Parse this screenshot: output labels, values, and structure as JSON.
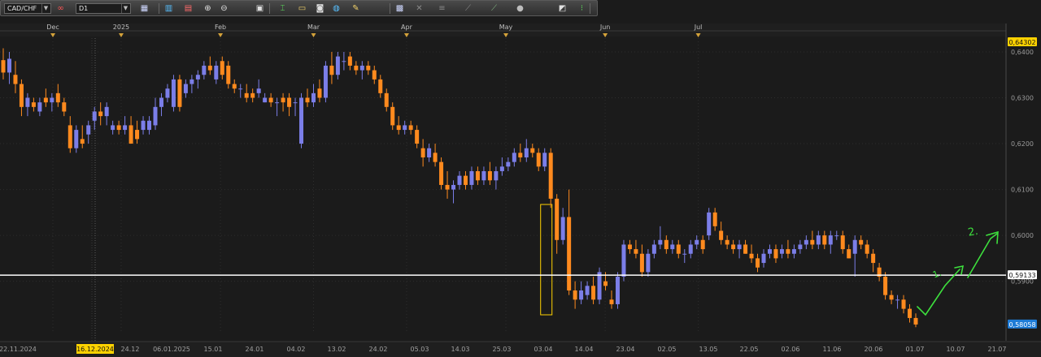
{
  "toolbar": {
    "symbol": "CAD/CHF",
    "timeframe": "D1",
    "icons": [
      {
        "name": "link-icon",
        "glyph": "∞",
        "color": "#ff5555"
      },
      {
        "name": "chart-type-icon",
        "glyph": "▦",
        "color": "#cfd8ff"
      },
      {
        "name": "bar-chart-icon",
        "glyph": "▥",
        "color": "#58c0ff"
      },
      {
        "name": "indicator-icon",
        "glyph": "▤",
        "color": "#ff6b6b"
      },
      {
        "name": "zoom-in-icon",
        "glyph": "⊕",
        "color": "#e0e0e0"
      },
      {
        "name": "zoom-out-icon",
        "glyph": "⊖",
        "color": "#e0e0e0"
      },
      {
        "name": "grid-icon",
        "glyph": "▣",
        "color": "#e0e0e0"
      },
      {
        "name": "cursor-icon",
        "glyph": "⌶",
        "color": "#5bdc5b"
      },
      {
        "name": "template-icon",
        "glyph": "▭",
        "color": "#f2d26a"
      },
      {
        "name": "camera-icon",
        "glyph": "◙",
        "color": "#e0e0e0"
      },
      {
        "name": "globe-icon",
        "glyph": "◍",
        "color": "#58c0ff"
      },
      {
        "name": "pencil-icon",
        "glyph": "✎",
        "color": "#f2d26a"
      },
      {
        "name": "tile-windows-icon",
        "glyph": "▩",
        "color": "#cfd8ff"
      },
      {
        "name": "crosshair-icon",
        "glyph": "✕",
        "color": "#8a8a8a"
      },
      {
        "name": "levels-icon",
        "glyph": "≡",
        "color": "#8a8a8a"
      },
      {
        "name": "trendline-icon",
        "glyph": "⟋",
        "color": "#8a8a8a"
      },
      {
        "name": "channel-icon",
        "glyph": "⟋",
        "color": "#7fb27f"
      },
      {
        "name": "shapes-icon",
        "glyph": "●",
        "color": "#bdbdbd"
      },
      {
        "name": "eraser-icon",
        "glyph": "◩",
        "color": "#e0e0e0"
      },
      {
        "name": "more-icon",
        "glyph": "⁝",
        "color": "#5bdc5b"
      }
    ]
  },
  "time_axis_top": [
    {
      "label": "Dec",
      "idx": 8
    },
    {
      "label": "2025",
      "idx": 19
    },
    {
      "label": "Feb",
      "idx": 35
    },
    {
      "label": "Mar",
      "idx": 50
    },
    {
      "label": "Apr",
      "idx": 65
    },
    {
      "label": "May",
      "idx": 81
    },
    {
      "label": "Jun",
      "idx": 97
    },
    {
      "label": "Jul",
      "idx": 112
    }
  ],
  "price_axis": {
    "labels": [
      "0,6400",
      "0,6300",
      "0,6200",
      "0,6100",
      "0,6000",
      "0,5900"
    ],
    "top_label": "0,64302",
    "hline_label": "0,59133",
    "last_label": "0,58058"
  },
  "date_axis": {
    "highlight": "16.12.2024",
    "labels": [
      "22.11.2024",
      "24.12",
      "06.01.2025",
      "15.01",
      "24.01",
      "04.02",
      "13.02",
      "24.02",
      "05.03",
      "14.03",
      "25.03",
      "03.04",
      "14.04",
      "23.04",
      "02.05",
      "13.05",
      "22.05",
      "02.06",
      "11.06",
      "20.06",
      "01.07",
      "10.07",
      "21.07"
    ]
  },
  "annotations": {
    "label1": "1.",
    "label2": "2.",
    "highlight_candle_index": 89
  },
  "chart_data": {
    "type": "candlestick",
    "symbol": "CAD/CHF",
    "timeframe": "D1",
    "ylim": [
      0.5788,
      0.643
    ],
    "horizontal_line": 0.59133,
    "last_price": 0.58058,
    "colors": {
      "up": "#7b7ee8",
      "down": "#ff8a1e",
      "background": "#1b1b1b",
      "grid": "#2e2e2e",
      "line": "#ffffff",
      "annotation": "#3de03d",
      "highlight": "#ffd200"
    },
    "candles": [
      [
        0.6382,
        0.6408,
        0.634,
        0.6355
      ],
      [
        0.6355,
        0.64,
        0.633,
        0.6385
      ],
      [
        0.635,
        0.638,
        0.631,
        0.633
      ],
      [
        0.633,
        0.634,
        0.626,
        0.628
      ],
      [
        0.628,
        0.631,
        0.626,
        0.63
      ],
      [
        0.629,
        0.63,
        0.627,
        0.628
      ],
      [
        0.627,
        0.63,
        0.626,
        0.629
      ],
      [
        0.63,
        0.632,
        0.628,
        0.629
      ],
      [
        0.629,
        0.631,
        0.627,
        0.63
      ],
      [
        0.631,
        0.633,
        0.628,
        0.629
      ],
      [
        0.629,
        0.63,
        0.626,
        0.627
      ],
      [
        0.624,
        0.626,
        0.618,
        0.619
      ],
      [
        0.619,
        0.624,
        0.618,
        0.623
      ],
      [
        0.621,
        0.624,
        0.619,
        0.62
      ],
      [
        0.622,
        0.625,
        0.62,
        0.624
      ],
      [
        0.625,
        0.628,
        0.623,
        0.627
      ],
      [
        0.627,
        0.629,
        0.624,
        0.626
      ],
      [
        0.626,
        0.629,
        0.624,
        0.628
      ],
      [
        0.623,
        0.625,
        0.622,
        0.624
      ],
      [
        0.624,
        0.625,
        0.622,
        0.623
      ],
      [
        0.623,
        0.626,
        0.622,
        0.624
      ],
      [
        0.624,
        0.626,
        0.62,
        0.62
      ],
      [
        0.623,
        0.625,
        0.62,
        0.621
      ],
      [
        0.623,
        0.626,
        0.622,
        0.625
      ],
      [
        0.623,
        0.626,
        0.622,
        0.625
      ],
      [
        0.624,
        0.63,
        0.623,
        0.628
      ],
      [
        0.628,
        0.631,
        0.626,
        0.63
      ],
      [
        0.63,
        0.633,
        0.629,
        0.632
      ],
      [
        0.628,
        0.635,
        0.627,
        0.634
      ],
      [
        0.634,
        0.635,
        0.627,
        0.628
      ],
      [
        0.631,
        0.634,
        0.63,
        0.633
      ],
      [
        0.633,
        0.635,
        0.631,
        0.634
      ],
      [
        0.634,
        0.636,
        0.632,
        0.635
      ],
      [
        0.635,
        0.638,
        0.634,
        0.637
      ],
      [
        0.637,
        0.639,
        0.635,
        0.636
      ],
      [
        0.634,
        0.638,
        0.633,
        0.637
      ],
      [
        0.638,
        0.639,
        0.634,
        0.635
      ],
      [
        0.637,
        0.638,
        0.632,
        0.633
      ],
      [
        0.633,
        0.634,
        0.631,
        0.632
      ],
      [
        0.632,
        0.633,
        0.63,
        0.632
      ],
      [
        0.631,
        0.633,
        0.629,
        0.63
      ],
      [
        0.631,
        0.632,
        0.629,
        0.63
      ],
      [
        0.631,
        0.634,
        0.63,
        0.632
      ],
      [
        0.629,
        0.631,
        0.629,
        0.63
      ],
      [
        0.63,
        0.631,
        0.628,
        0.629
      ],
      [
        0.629,
        0.63,
        0.626,
        0.629
      ],
      [
        0.63,
        0.631,
        0.627,
        0.629
      ],
      [
        0.63,
        0.631,
        0.626,
        0.628
      ],
      [
        0.629,
        0.63,
        0.626,
        0.629
      ],
      [
        0.62,
        0.631,
        0.619,
        0.63
      ],
      [
        0.63,
        0.632,
        0.628,
        0.629
      ],
      [
        0.629,
        0.633,
        0.628,
        0.631
      ],
      [
        0.632,
        0.634,
        0.629,
        0.63
      ],
      [
        0.63,
        0.638,
        0.629,
        0.637
      ],
      [
        0.637,
        0.64,
        0.633,
        0.635
      ],
      [
        0.635,
        0.64,
        0.634,
        0.639
      ],
      [
        0.638,
        0.64,
        0.636,
        0.638
      ],
      [
        0.639,
        0.64,
        0.636,
        0.637
      ],
      [
        0.637,
        0.638,
        0.635,
        0.636
      ],
      [
        0.636,
        0.638,
        0.634,
        0.637
      ],
      [
        0.637,
        0.638,
        0.635,
        0.636
      ],
      [
        0.636,
        0.637,
        0.633,
        0.634
      ],
      [
        0.634,
        0.635,
        0.63,
        0.631
      ],
      [
        0.631,
        0.632,
        0.627,
        0.628
      ],
      [
        0.628,
        0.629,
        0.623,
        0.624
      ],
      [
        0.624,
        0.626,
        0.622,
        0.623
      ],
      [
        0.623,
        0.625,
        0.622,
        0.624
      ],
      [
        0.624,
        0.625,
        0.622,
        0.623
      ],
      [
        0.623,
        0.624,
        0.619,
        0.62
      ],
      [
        0.619,
        0.621,
        0.615,
        0.617
      ],
      [
        0.617,
        0.62,
        0.616,
        0.619
      ],
      [
        0.618,
        0.62,
        0.615,
        0.616
      ],
      [
        0.616,
        0.617,
        0.61,
        0.611
      ],
      [
        0.611,
        0.614,
        0.608,
        0.61
      ],
      [
        0.61,
        0.612,
        0.607,
        0.611
      ],
      [
        0.611,
        0.614,
        0.61,
        0.613
      ],
      [
        0.613,
        0.614,
        0.61,
        0.611
      ],
      [
        0.611,
        0.615,
        0.61,
        0.614
      ],
      [
        0.614,
        0.615,
        0.611,
        0.612
      ],
      [
        0.612,
        0.615,
        0.611,
        0.614
      ]
    ]
  }
}
